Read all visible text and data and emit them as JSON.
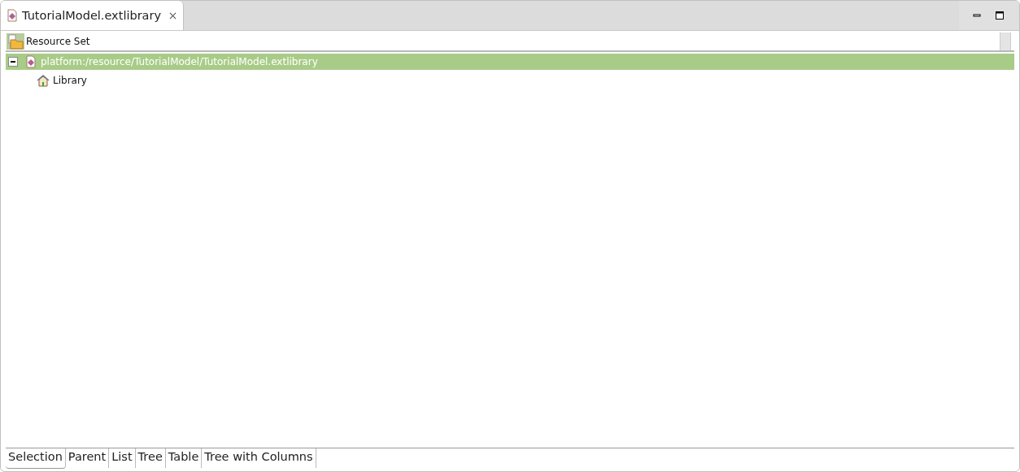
{
  "editor_tab": {
    "title": "TutorialModel.extlibrary",
    "selected": true
  },
  "header": {
    "label": "Resource Set"
  },
  "tree": [
    {
      "label": "platform:/resource/TutorialModel/TutorialModel.extlibrary",
      "kind": "resource",
      "expanded": true,
      "selected": true,
      "children": [
        {
          "label": "Library",
          "kind": "library",
          "selected": false
        }
      ]
    }
  ],
  "bottom_tabs": [
    {
      "label": "Selection",
      "selected": true
    },
    {
      "label": "Parent",
      "selected": false
    },
    {
      "label": "List",
      "selected": false
    },
    {
      "label": "Tree",
      "selected": false
    },
    {
      "label": "Table",
      "selected": false
    },
    {
      "label": "Tree with Columns",
      "selected": false
    }
  ]
}
